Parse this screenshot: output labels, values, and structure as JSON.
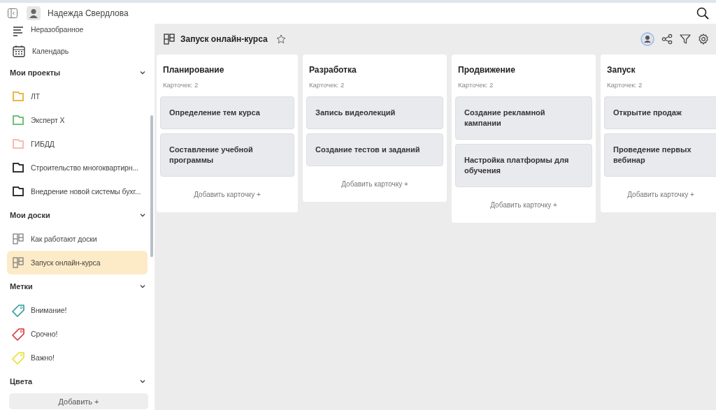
{
  "header": {
    "user_name": "Надежда Свердлова"
  },
  "sidebar": {
    "nav": [
      {
        "label": "Неразобранное",
        "kind": "list"
      },
      {
        "label": "Календарь",
        "kind": "calendar"
      }
    ],
    "sections": [
      {
        "title": "Мои проекты",
        "expanded": true,
        "kind": "folders",
        "items": [
          {
            "label": "ЛТ",
            "color": "#f0b445"
          },
          {
            "label": "Эксперт Х",
            "color": "#72c07a"
          },
          {
            "label": "ГИБДД",
            "color": "#f5bcae"
          },
          {
            "label": "Строительство многоквартирн...",
            "color": "#333333"
          },
          {
            "label": "Внедрение новой системы бухг...",
            "color": "#333333"
          }
        ]
      },
      {
        "title": "Мои доски",
        "expanded": true,
        "kind": "boards",
        "items": [
          {
            "label": "Как работают доски",
            "selected": false
          },
          {
            "label": "Запуск онлайн-курса",
            "selected": true
          }
        ]
      },
      {
        "title": "Метки",
        "expanded": true,
        "kind": "tags",
        "items": [
          {
            "label": "Внимание!",
            "color": "#2a9a98"
          },
          {
            "label": "Срочно!",
            "color": "#d8303a"
          },
          {
            "label": "Важно!",
            "color": "#e6e02a"
          }
        ]
      },
      {
        "title": "Цвета",
        "expanded": true
      }
    ],
    "add_button": "Добавить +"
  },
  "board": {
    "title": "Запуск онлайн-курса",
    "starred": false,
    "columns": [
      {
        "title": "Планирование",
        "count": "Карточек: 2",
        "cards": [
          "Определение тем курса",
          "Составление учебной программы"
        ],
        "add_label": "Добавить карточку +"
      },
      {
        "title": "Разработка",
        "count": "Карточек: 2",
        "cards": [
          "Запись видеолекций",
          "Создание тестов и заданий"
        ],
        "add_label": "Добавить карточку +"
      },
      {
        "title": "Продвижение",
        "count": "Карточек: 2",
        "cards": [
          "Создание рекламной кампании",
          "Настройка платформы для обучения"
        ],
        "add_label": "Добавить карточку +"
      },
      {
        "title": "Запуск",
        "count": "Карточек: 2",
        "cards": [
          "Открытие продаж",
          "Проведение первых вебинар"
        ],
        "add_label": "Добавить карточку +"
      }
    ]
  }
}
